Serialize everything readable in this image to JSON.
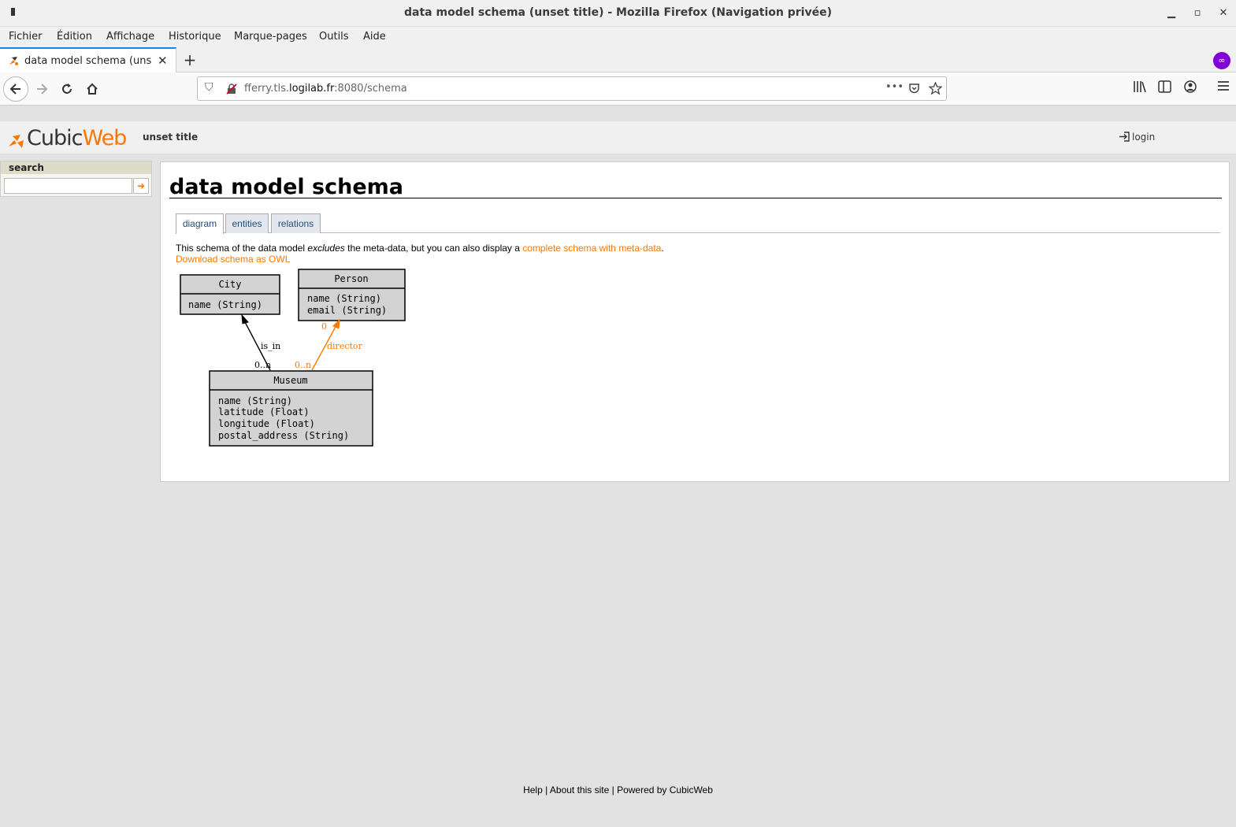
{
  "window": {
    "title": "data model schema (unset title) - Mozilla Firefox (Navigation privée)",
    "controls": {
      "minimize": "▁",
      "maximize": "▫",
      "close": "✕"
    }
  },
  "menu": [
    "Fichier",
    "Édition",
    "Affichage",
    "Historique",
    "Marque-pages",
    "Outils",
    "Aide"
  ],
  "tab": {
    "label": "data model schema (unset title)",
    "close": "✕",
    "new": "+"
  },
  "nav": {
    "url_host_prefix": "fferry.tls.",
    "url_host": "logilab.fr",
    "url_rest": ":8080/schema",
    "more": "•••"
  },
  "header": {
    "logo_a": "Cubic",
    "logo_b": "Web",
    "site_title": "unset title",
    "login": "login"
  },
  "search": {
    "title": "search",
    "value": "",
    "go": "➜"
  },
  "main": {
    "title": "data model schema",
    "tabs": [
      "diagram",
      "entities",
      "relations"
    ],
    "active_tab": "diagram",
    "intro_before": "This schema of the data model ",
    "intro_em": "excludes",
    "intro_after": " the meta-data, but you can also display a ",
    "intro_link": "complete schema with meta-data",
    "intro_end": ".",
    "owl_link": "Download schema as OWL"
  },
  "diagram": {
    "entities": [
      {
        "name": "City",
        "attrs": [
          "name (String)"
        ]
      },
      {
        "name": "Person",
        "attrs": [
          "name (String)",
          "email (String)"
        ]
      },
      {
        "name": "Museum",
        "attrs": [
          "name (String)",
          "latitude (Float)",
          "longitude (Float)",
          "postal_address (String)"
        ]
      }
    ],
    "relations": [
      {
        "name": "is_in",
        "from": "Museum",
        "to": "City",
        "cardinality_from": "0..n",
        "color": "#000000"
      },
      {
        "name": "director",
        "from": "Museum",
        "to": "Person",
        "cardinality_from": "0..n",
        "cardinality_to": "0",
        "color": "#ff7700"
      }
    ]
  },
  "footer": {
    "help": "Help",
    "sep1": " | ",
    "about": "About this site",
    "sep2": " | ",
    "powered": "Powered by CubicWeb"
  },
  "colors": {
    "accent": "#ff7700",
    "entity_fill": "#d3d3d3",
    "private": "#8000d7"
  }
}
